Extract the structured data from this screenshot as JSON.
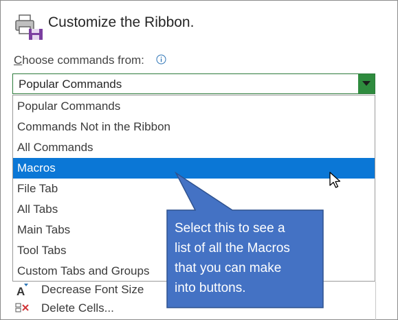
{
  "header": {
    "title": "Customize the Ribbon."
  },
  "choose": {
    "label_first": "C",
    "label_rest": "hoose commands from:"
  },
  "combo": {
    "value": "Popular Commands"
  },
  "dropdown": {
    "options": [
      {
        "label": "Popular Commands",
        "selected": false
      },
      {
        "label": "Commands Not in the Ribbon",
        "selected": false
      },
      {
        "label": "All Commands",
        "selected": false
      },
      {
        "label": "Macros",
        "selected": true
      },
      {
        "label": "File Tab",
        "selected": false
      },
      {
        "label": "All Tabs",
        "selected": false
      },
      {
        "label": "Main Tabs",
        "selected": false
      },
      {
        "label": "Tool Tabs",
        "selected": false
      },
      {
        "label": "Custom Tabs and Groups",
        "selected": false
      }
    ]
  },
  "commands_list": {
    "items": [
      {
        "label": "Decrease Font Size",
        "icon": "decrease-font-icon"
      },
      {
        "label": "Delete Cells...",
        "icon": "delete-cells-icon"
      }
    ]
  },
  "callout": {
    "line1": "Select this to see a",
    "line2": "list of all the Macros",
    "line3": "that you can make",
    "line4": "into buttons."
  },
  "colors": {
    "selection": "#0b77d6",
    "callout_fill": "#4472c4",
    "callout_border": "#2f528f",
    "combo_button": "#2e8b3e"
  }
}
